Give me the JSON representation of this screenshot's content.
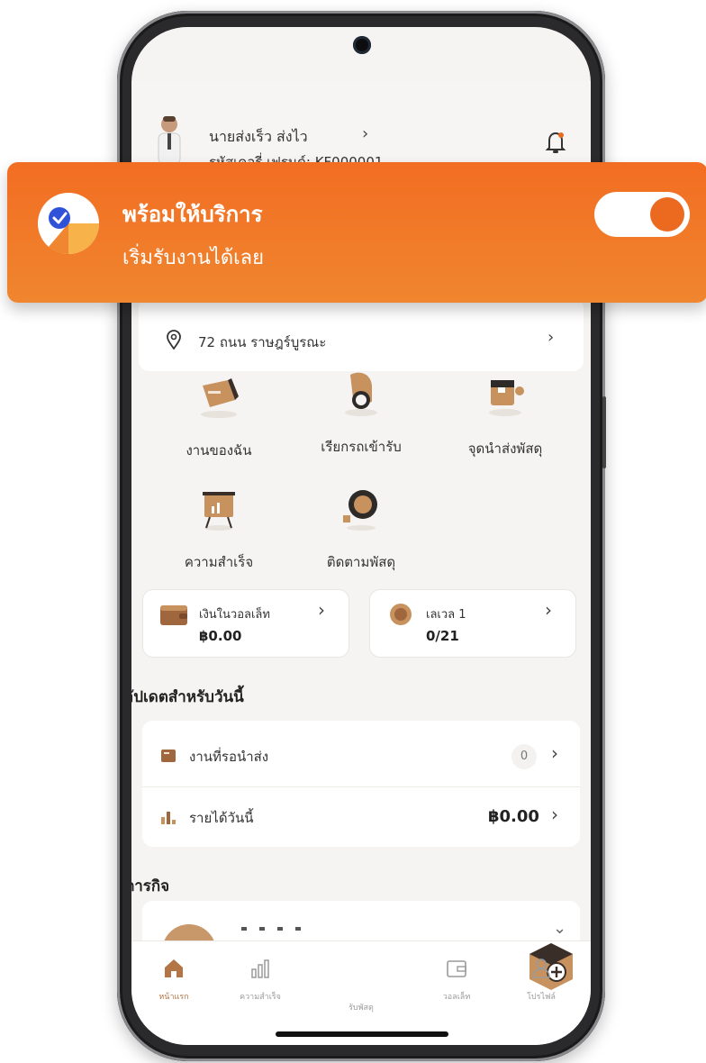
{
  "header": {
    "name": "นายส่งเร็ว ส่งไว",
    "partner_code": "รหัสเคอรี่ เฟรนด์: KF000001"
  },
  "banner": {
    "title": "พร้อมให้บริการ",
    "subtitle": "เริ่มรับงานได้เลย",
    "toggle_state": "on"
  },
  "address": {
    "text": "72 ถนน ราษฎร์บูรณะ"
  },
  "menu": [
    {
      "label": "งานของฉัน",
      "icon": "package-box-icon"
    },
    {
      "label": "เรียกรถเข้ารับ",
      "icon": "delivery-helmet-icon"
    },
    {
      "label": "จุดนำส่งพัสดุ",
      "icon": "dropoff-point-icon"
    },
    {
      "label": "ความสำเร็จ",
      "icon": "achievement-board-icon"
    },
    {
      "label": "ติดตามพัสดุ",
      "icon": "track-parcel-icon"
    }
  ],
  "wallet": {
    "title": "เงินในวอลเล็ท",
    "value": "฿0.00"
  },
  "level": {
    "title": "เลเวล 1",
    "value": "0/21"
  },
  "updates": {
    "heading": "อัปเดตสำหรับวันนี้",
    "pending_label": "งานที่รอนำส่ง",
    "pending_count": "0",
    "income_label": "รายได้วันนี้",
    "income_value": "฿0.00"
  },
  "missions": {
    "heading": "ภารกิจ"
  },
  "nav": [
    {
      "label": "หน้าแรก",
      "icon": "home-icon",
      "active": true
    },
    {
      "label": "ความสำเร็จ",
      "icon": "bar-chart-icon",
      "active": false
    },
    {
      "label": "รับพัสดุ",
      "icon": "add-parcel-icon",
      "active": false
    },
    {
      "label": "วอลเล็ท",
      "icon": "wallet-icon",
      "active": false
    },
    {
      "label": "โปรไฟล์",
      "icon": "profile-icon",
      "active": false
    }
  ],
  "colors": {
    "accent_orange": "#f26d22",
    "brand_brown": "#b47546"
  }
}
